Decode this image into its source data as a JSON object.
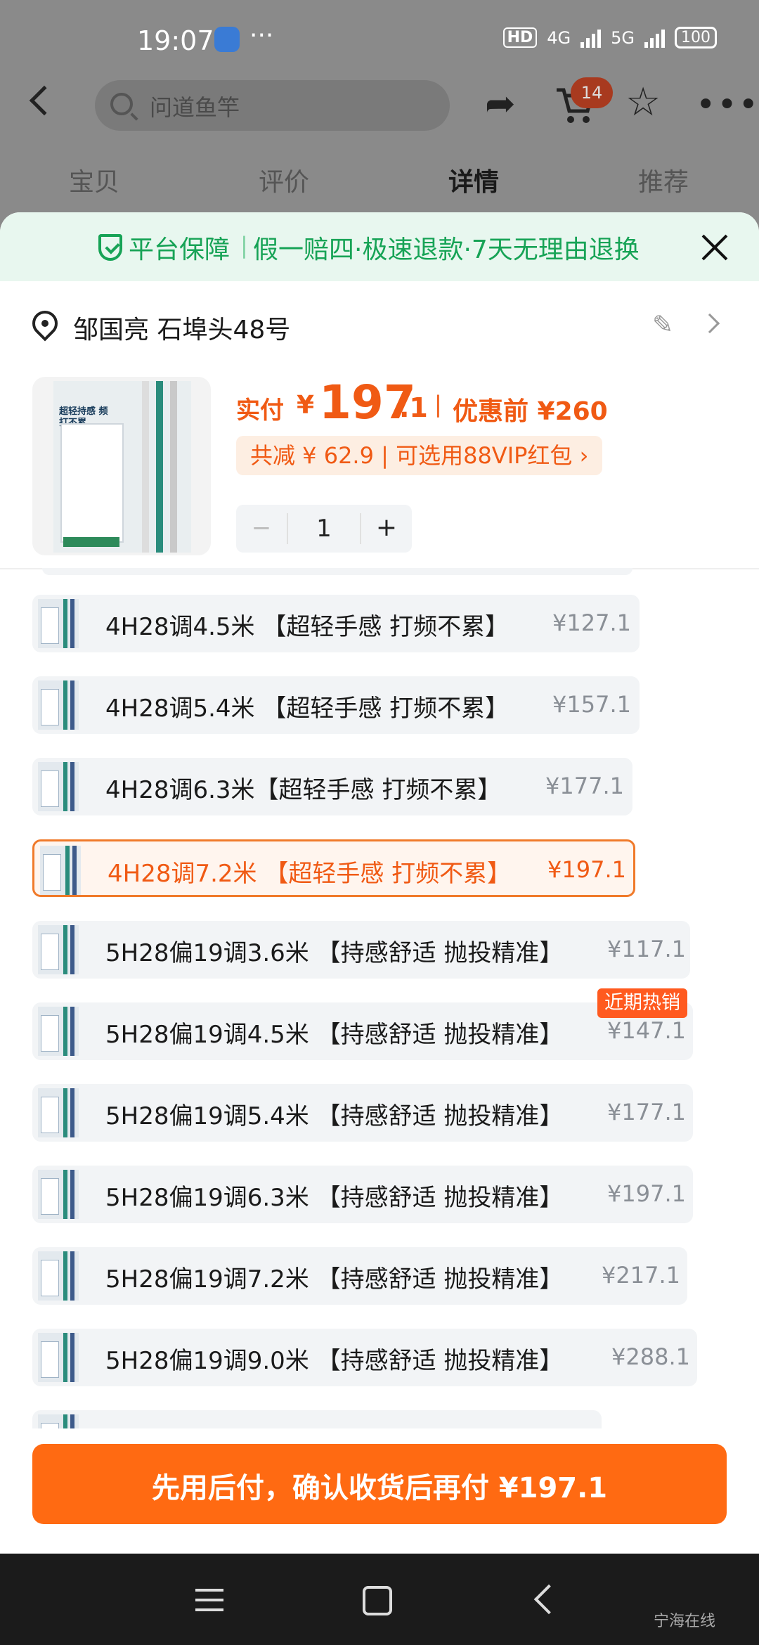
{
  "status": {
    "time": "19:07",
    "hd": "HD",
    "net1": "4G",
    "net2": "5G",
    "battery": "100"
  },
  "header": {
    "search_placeholder": "问道鱼竿",
    "cart_count": "14"
  },
  "tabs": [
    {
      "label": "宝贝"
    },
    {
      "label": "评价"
    },
    {
      "label": "详情"
    },
    {
      "label": "推荐"
    }
  ],
  "guarantee": {
    "title": "平台保障",
    "sep": "|",
    "text": "假一赔四·极速退款·7天无理由退换"
  },
  "address": {
    "text": "邹国亮 石埠头48号"
  },
  "product": {
    "image_caption": "超轻持感 频打不累",
    "pay_label": "实付",
    "currency": "¥",
    "pay_int": "197",
    "pay_dec": ".1",
    "sep": "|",
    "pre_label": "优惠前 ¥260",
    "discount": "共减 ¥ 62.9 | 可选用88VIP红包 ›",
    "qty": "1",
    "minus": "−",
    "plus": "+"
  },
  "options": [
    {
      "name": "4H28调4.5米 【超轻手感 打频不累】",
      "price": "¥127.1"
    },
    {
      "name": "4H28调5.4米 【超轻手感 打频不累】",
      "price": "¥157.1"
    },
    {
      "name": "4H28调6.3米【超轻手感 打频不累】",
      "price": "¥177.1"
    },
    {
      "name": "4H28调7.2米 【超轻手感 打频不累】",
      "price": "¥197.1",
      "selected": true
    },
    {
      "name": "5H28偏19调3.6米 【持感舒适 抛投精准】",
      "price": "¥117.1"
    },
    {
      "name": "5H28偏19调4.5米 【持感舒适 抛投精准】",
      "price": "¥147.1"
    },
    {
      "name": "5H28偏19调5.4米 【持感舒适 抛投精准】",
      "price": "¥177.1"
    },
    {
      "name": "5H28偏19调6.3米 【持感舒适 抛投精准】",
      "price": "¥197.1"
    },
    {
      "name": "5H28偏19调7.2米 【持感舒适 抛投精准】",
      "price": "¥217.1"
    },
    {
      "name": "5H28偏19调9.0米 【持感舒适 抛投精准】",
      "price": "¥288.1"
    }
  ],
  "hot_badge": "近期热销",
  "cta": {
    "label": "先用后付，确认收货后再付 ¥197.1"
  },
  "watermark": "宁海在线"
}
